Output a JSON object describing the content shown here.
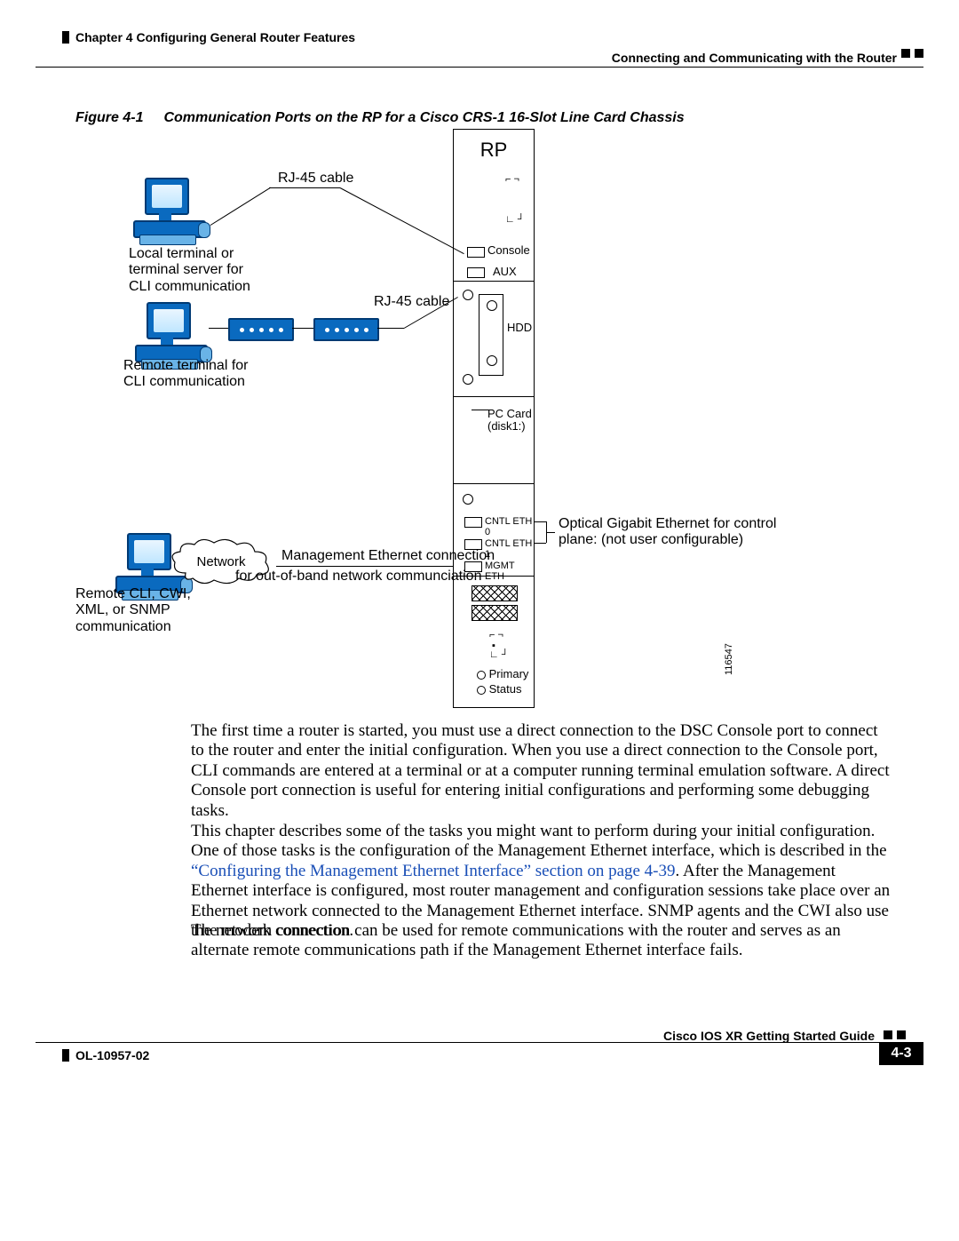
{
  "header": {
    "chapter": "Chapter 4      Configuring General Router Features",
    "section": "Connecting and Communicating with the Router"
  },
  "figure": {
    "number": "Figure 4-1",
    "title": "Communication Ports on the RP for a Cisco CRS-1 16-Slot Line Card Chassis",
    "rp_title": "RP",
    "labels": {
      "rj45_top": "RJ-45 cable",
      "local_terminal_l1": "Local terminal or",
      "local_terminal_l2": "terminal server for",
      "local_terminal_l3": "CLI communication",
      "remote_terminal_l1": "Remote terminal for",
      "remote_terminal_l2": "CLI communication",
      "rj45_mid": "RJ-45 cable",
      "network": "Network",
      "mgmt_l1": "Management Ethernet connection",
      "mgmt_l2": "for out-of-band network communciation",
      "remote_snmp_l1": "Remote CLI, CWI,",
      "remote_snmp_l2": "XML, or SNMP",
      "remote_snmp_l3": "communication",
      "optical_l1": "Optical Gigabit Ethernet for control",
      "optical_l2": "plane: (not user configurable)"
    },
    "ports": {
      "console": "Console",
      "aux": "AUX",
      "hdd": "HDD",
      "pccard_l1": "PC Card",
      "pccard_l2": "(disk1:)",
      "cntl0": "CNTL ETH 0",
      "cntl1": "CNTL ETH 1",
      "mgmt": "MGMT ETH",
      "primary": "Primary",
      "status": "Status"
    },
    "image_id": "116547"
  },
  "body": {
    "p1": "The first time a router is started, you must use a direct connection to the DSC Console port to connect to the router and enter the initial configuration. When you use a direct connection to the Console port, CLI commands are entered at a terminal or at a computer running terminal emulation software. A direct Console port connection is useful for entering initial configurations and performing some debugging tasks.",
    "p2a": "This chapter describes some of the tasks you might want to perform during your initial configuration. One of those tasks is the configuration of the Management Ethernet interface, which is described in the ",
    "p2_link": "“Configuring the Management Ethernet Interface” section on page 4-39",
    "p2b": ". After the Management Ethernet interface is configured, most router management and configuration sessions take place over an Ethernet network connected to the Management Ethernet interface. SNMP agents and the CWI also use the network connection.",
    "p3": "The modem connection can be used for remote communications with the router and serves as an alternate remote communications path if the Management Ethernet interface fails."
  },
  "footer": {
    "guide": "Cisco IOS XR Getting Started Guide",
    "docnum": "OL-10957-02",
    "pagenum": "4-3"
  }
}
